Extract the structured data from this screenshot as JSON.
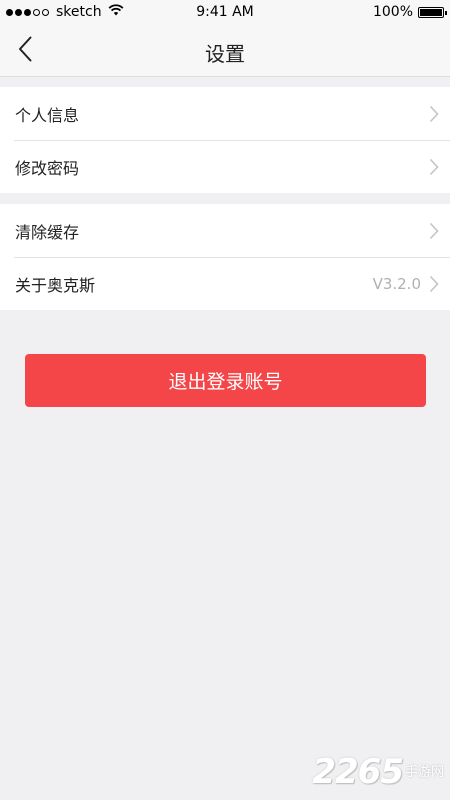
{
  "status_bar": {
    "carrier": "sketch",
    "time": "9:41 AM",
    "battery": "100%",
    "signal_filled": 3,
    "signal_total": 5
  },
  "nav": {
    "back_icon": "chevron-left-icon",
    "title": "设置"
  },
  "groups": [
    {
      "items": [
        {
          "label": "个人信息",
          "value": ""
        },
        {
          "label": "修改密码",
          "value": ""
        }
      ]
    },
    {
      "items": [
        {
          "label": "清除缓存",
          "value": ""
        },
        {
          "label": "关于奥克斯",
          "value": "V3.2.0"
        }
      ]
    }
  ],
  "logout": {
    "label": "退出登录账号",
    "color": "#f44648"
  },
  "watermark": {
    "number": "2265",
    "text": "手游网"
  },
  "colors": {
    "background": "#f0f0f2",
    "accent": "#f44648",
    "chevron": "#c4c4c4"
  }
}
